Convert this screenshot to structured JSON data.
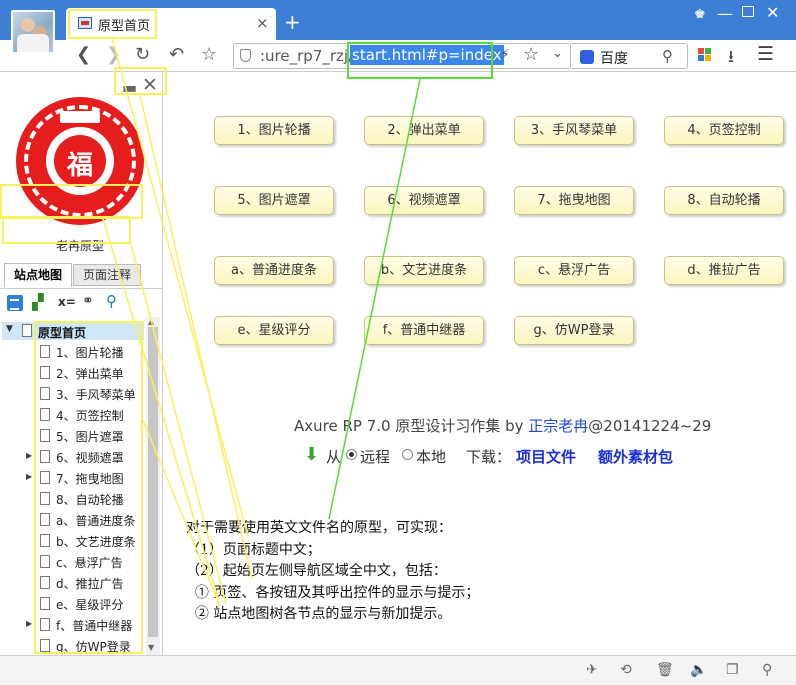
{
  "browser": {
    "tab_title": "原型首页",
    "tab_close": "×",
    "new_tab": "+",
    "url_prefix": ":ure_rp7_rzj/",
    "url_selected": "start.html#p=index",
    "search_engine": "百度"
  },
  "left_panel": {
    "logo_char": "福",
    "logo_caption": "老冉原型",
    "tabs": [
      "站点地图",
      "页面注释"
    ],
    "tree_root": "原型首页",
    "tree_items": [
      {
        "label": "1、图片轮播",
        "expandable": false
      },
      {
        "label": "2、弹出菜单",
        "expandable": false
      },
      {
        "label": "3、手风琴菜单",
        "expandable": false
      },
      {
        "label": "4、页签控制",
        "expandable": false
      },
      {
        "label": "5、图片遮罩",
        "expandable": false
      },
      {
        "label": "6、视频遮罩",
        "expandable": true
      },
      {
        "label": "7、拖曳地图",
        "expandable": true
      },
      {
        "label": "8、自动轮播",
        "expandable": false
      },
      {
        "label": "a、普通进度条",
        "expandable": false
      },
      {
        "label": "b、文艺进度条",
        "expandable": false
      },
      {
        "label": "c、悬浮广告",
        "expandable": false
      },
      {
        "label": "d、推拉广告",
        "expandable": false
      },
      {
        "label": "e、星级评分",
        "expandable": false
      },
      {
        "label": "f、普通中继器",
        "expandable": true
      },
      {
        "label": "g、仿WP登录",
        "expandable": false
      }
    ]
  },
  "main": {
    "buttons": [
      [
        "1、图片轮播",
        "2、弹出菜单",
        "3、手风琴菜单",
        "4、页签控制"
      ],
      [
        "5、图片遮罩",
        "6、视频遮罩",
        "7、拖曳地图",
        "8、自动轮播"
      ],
      [
        "a、普通进度条",
        "b、文艺进度条",
        "c、悬浮广告",
        "d、推拉广告"
      ],
      [
        "e、星级评分",
        "f、普通中继器",
        "g、仿WP登录"
      ]
    ],
    "credit_prefix": "Axure RP 7.0 原型设计习作集 by ",
    "credit_author": "正宗老冉",
    "credit_suffix": "@20141224~29",
    "source_from": "从",
    "source_remote": "远程",
    "source_local": "本地",
    "source_download": "下载：",
    "link_project": "项目文件",
    "link_extra": "额外素材包",
    "notes": [
      "对于需要使用英文文件名的原型，可实现：",
      "（1）页面标题中文；",
      "（2）起始页左侧导航区域全中文，包括：",
      "  ① 页签、各按钮及其呼出控件的显示与提示；",
      "  ② 站点地图树各节点的显示与新加提示。"
    ]
  },
  "colors": {
    "chrome_blue": "#3d7fd5",
    "annotation_yellow": "#f7f25a",
    "annotation_green": "#55dd33",
    "button_fill": "#fbf5bf",
    "link_blue": "#1a2fd6"
  }
}
